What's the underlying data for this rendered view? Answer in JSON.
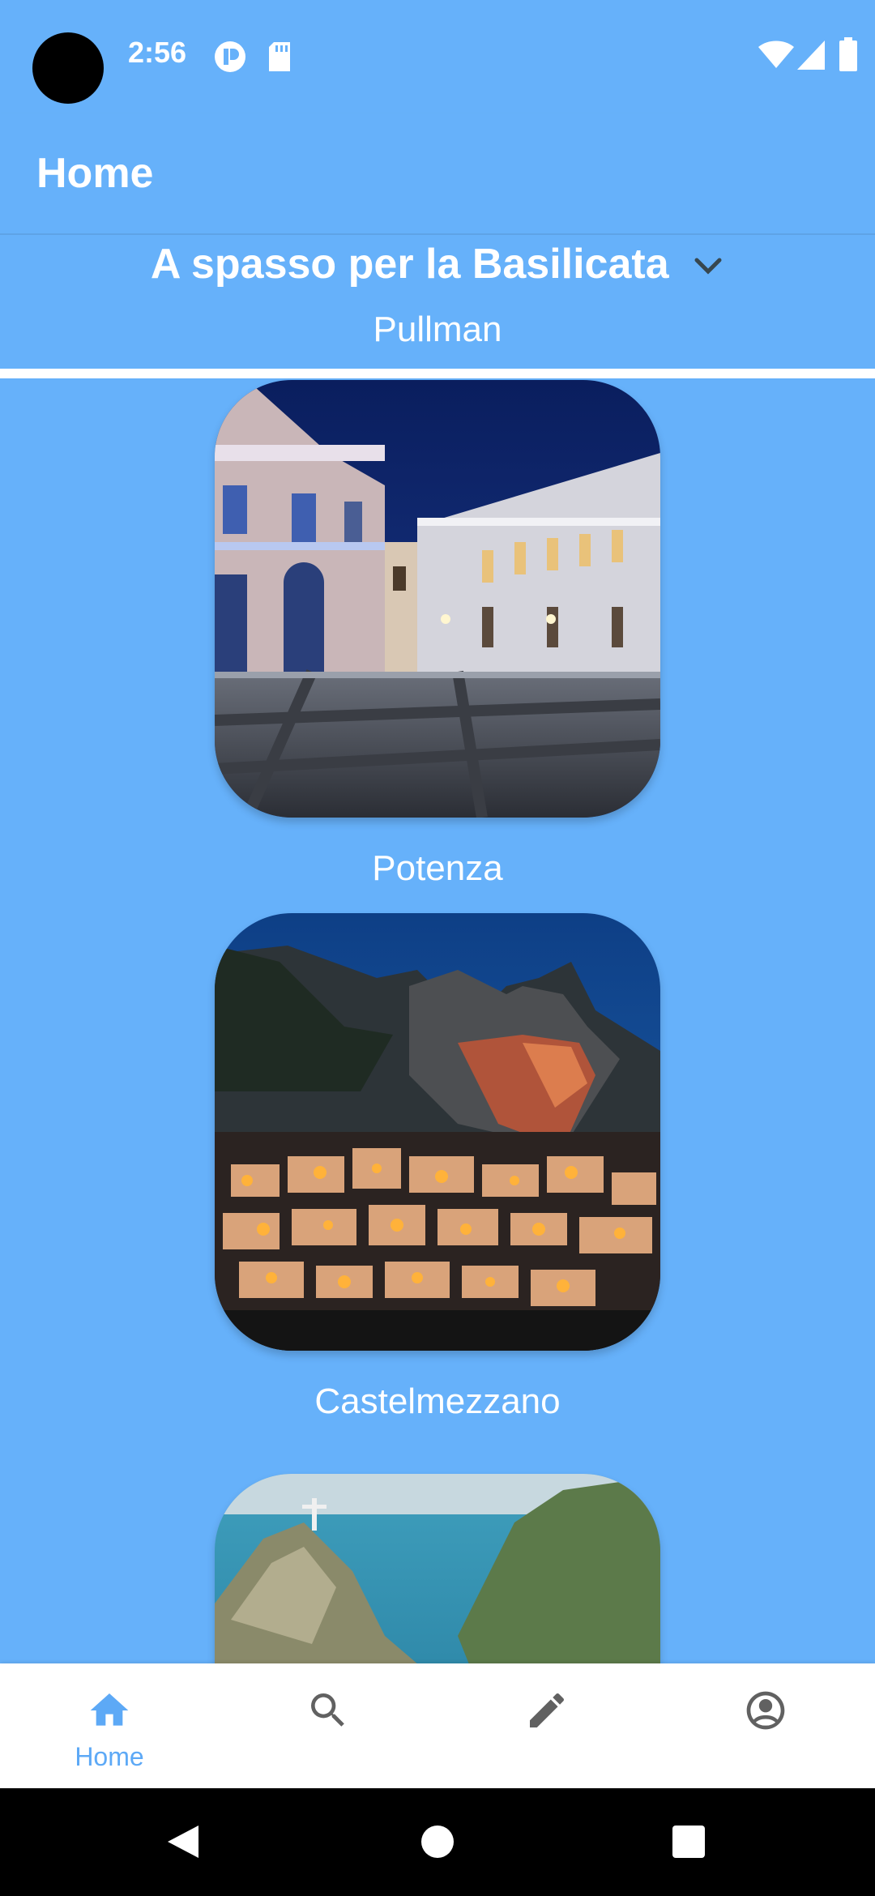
{
  "status_bar": {
    "time": "2:56",
    "icons": [
      "camera-cutout",
      "media-icon",
      "sdcard-icon",
      "wifi-icon",
      "signal-icon",
      "battery-icon"
    ]
  },
  "app_bar": {
    "title": "Home"
  },
  "tour": {
    "title": "A spasso per la Basilicata",
    "subtitle": "Pullman"
  },
  "cities": [
    {
      "name": "Potenza"
    },
    {
      "name": "Castelmezzano"
    },
    {
      "name": ""
    }
  ],
  "bottom_nav": {
    "items": [
      {
        "icon": "home-icon",
        "label": "Home",
        "active": true
      },
      {
        "icon": "search-icon",
        "label": "",
        "active": false
      },
      {
        "icon": "edit-icon",
        "label": "",
        "active": false
      },
      {
        "icon": "account-icon",
        "label": "",
        "active": false
      }
    ]
  },
  "colors": {
    "background": "#66b1fa",
    "accent": "#5da9f6",
    "icon_gray": "#616161"
  }
}
